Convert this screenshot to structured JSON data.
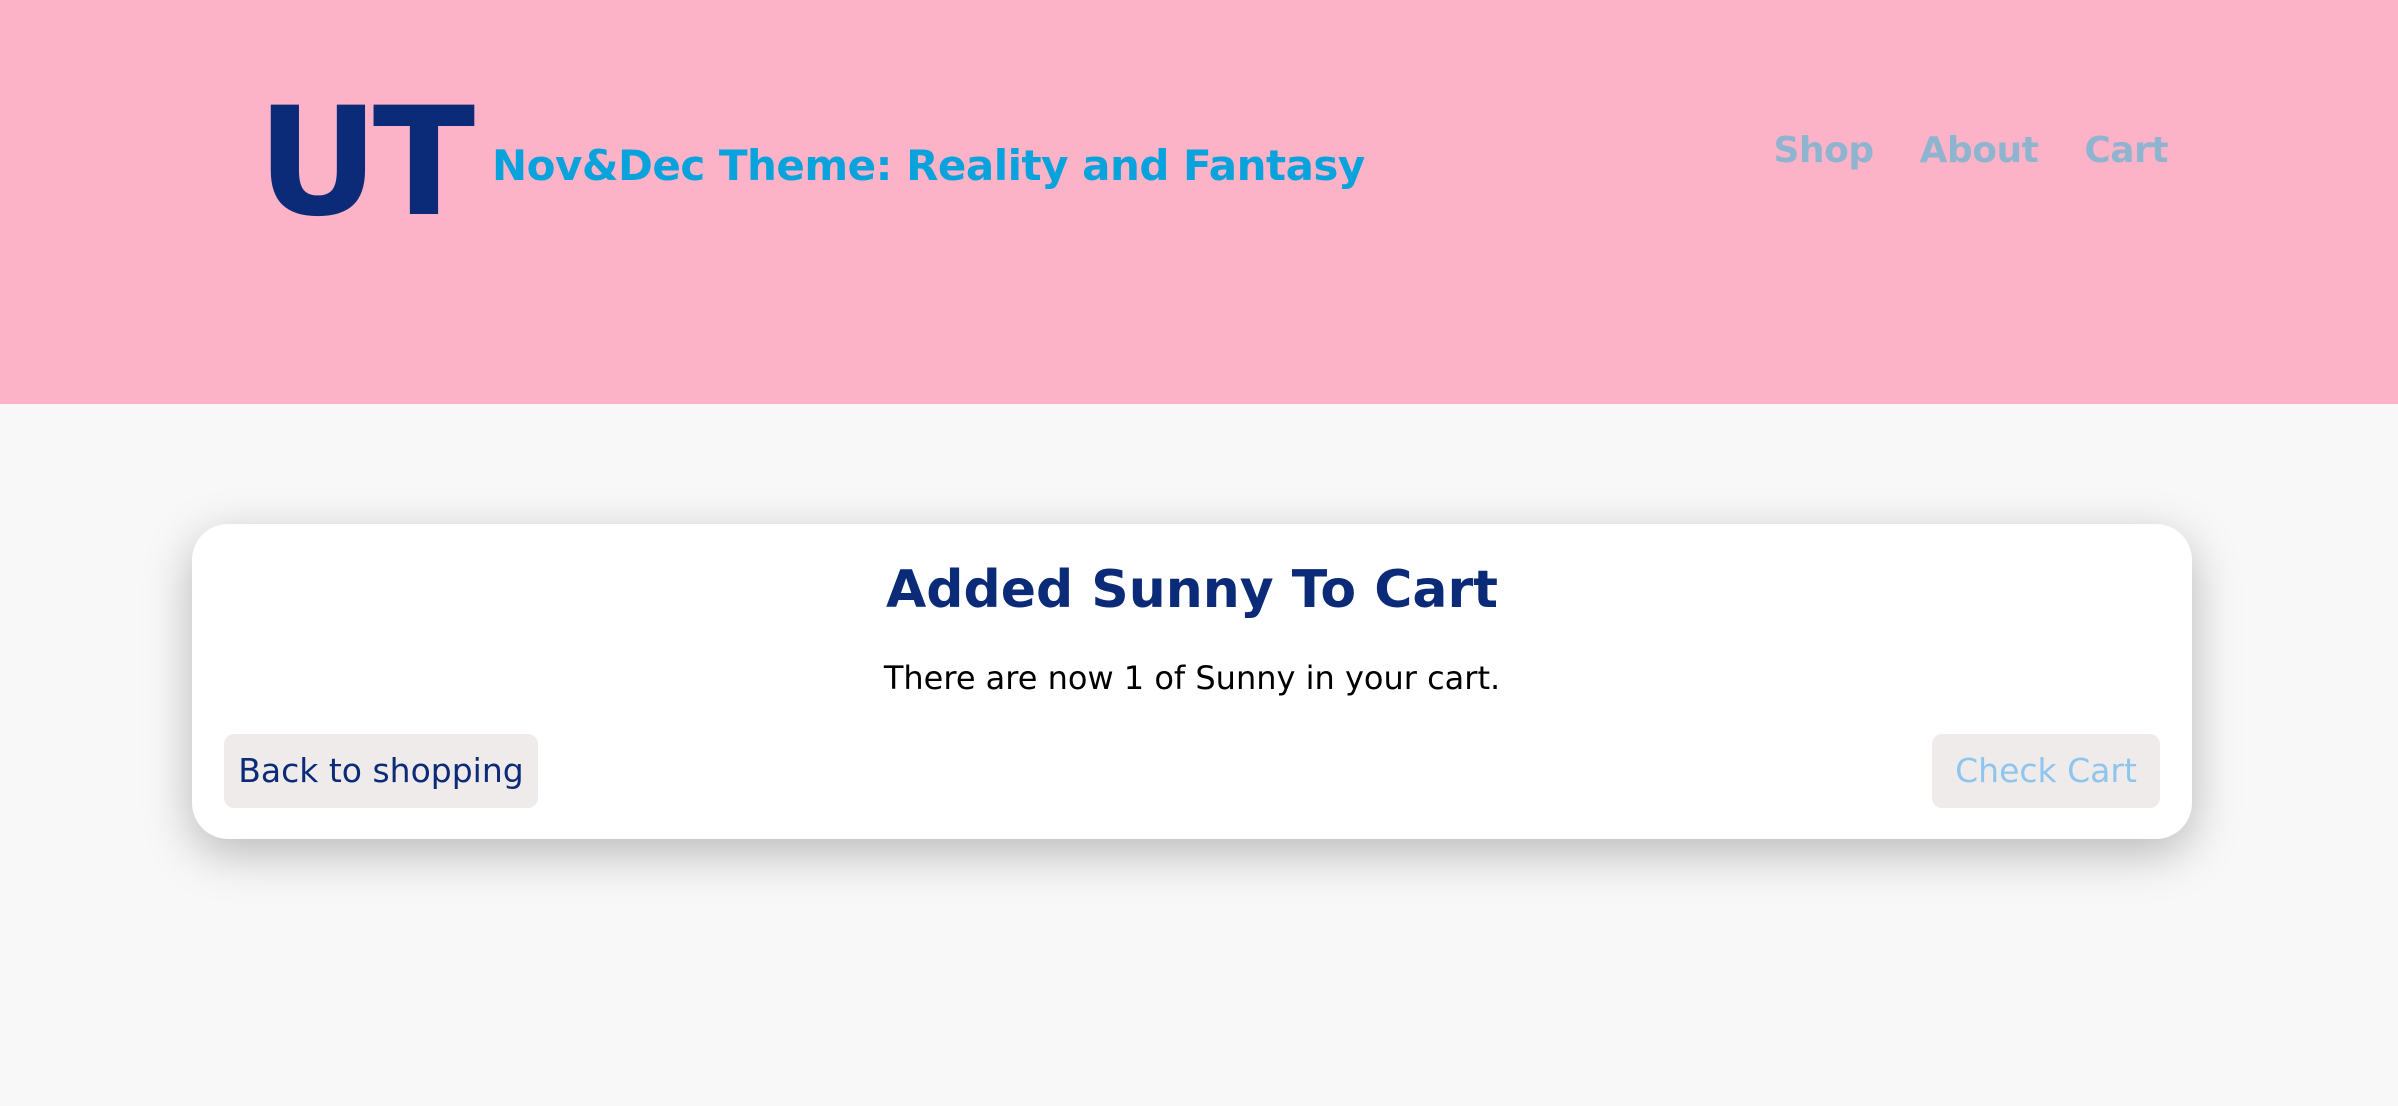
{
  "header": {
    "logo": "UT",
    "title": "Nov&Dec Theme: Reality and Fantasy",
    "nav": [
      {
        "label": "Shop"
      },
      {
        "label": "About"
      },
      {
        "label": "Cart"
      }
    ]
  },
  "modal": {
    "title": "Added Sunny To Cart",
    "message": "There are now 1 of Sunny in your cart.",
    "back_label": "Back to shopping",
    "check_label": "Check Cart"
  },
  "colors": {
    "header_bg": "#fdb3c7",
    "brand_navy": "#0b2a78",
    "title_blue": "#08a2dd",
    "nav_gray_blue": "#8fb4d0",
    "button_bg": "#efebeb",
    "check_cart_text": "#8ec5ee"
  }
}
